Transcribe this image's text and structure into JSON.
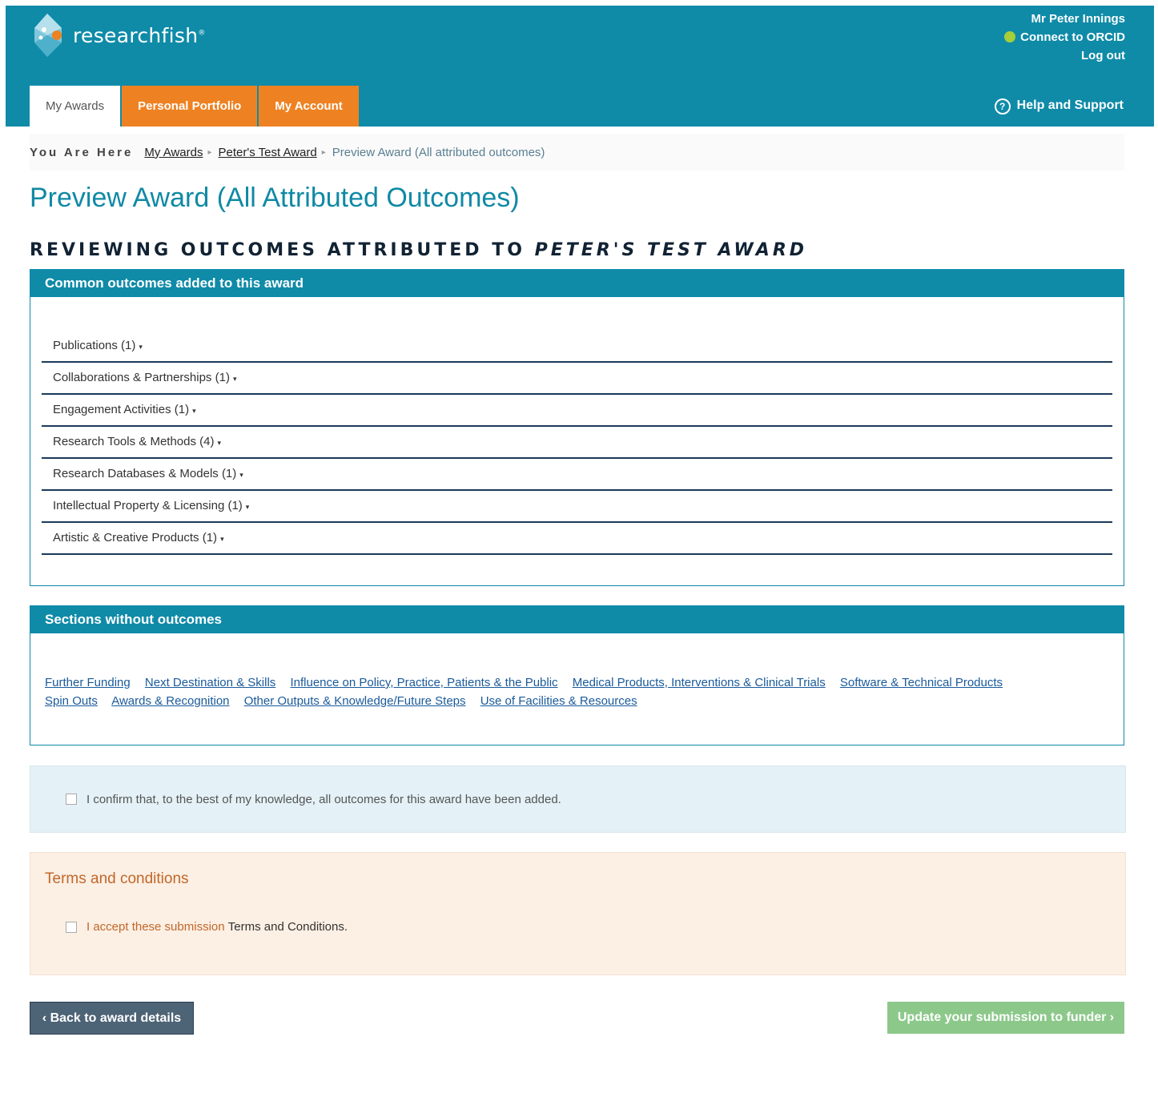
{
  "header": {
    "logo_text": "researchfish",
    "logo_reg": "®",
    "user_name": "Mr Peter Innings",
    "orcid_link": "Connect to ORCID",
    "logout": "Log out",
    "help": "Help and Support",
    "help_icon": "question-circle-icon",
    "tabs": [
      {
        "label": "My Awards",
        "active": true
      },
      {
        "label": "Personal Portfolio",
        "active": false
      },
      {
        "label": "My Account",
        "active": false
      }
    ],
    "colors": {
      "header_bg": "#0f8ba8",
      "tab_orange": "#ee8222"
    }
  },
  "breadcrumb": {
    "prefix": "You Are Here",
    "items": [
      "My Awards",
      "Peter's Test Award"
    ],
    "current": "Preview Award (All attributed outcomes)"
  },
  "page": {
    "title": "Preview Award (All Attributed Outcomes)",
    "subtitle_prefix": "REVIEWING OUTCOMES ATTRIBUTED TO",
    "subtitle_award": "PETER'S TEST AWARD"
  },
  "common_outcomes": {
    "heading": "Common outcomes added to this award",
    "items": [
      "Publications (1)",
      "Collaborations & Partnerships (1)",
      "Engagement Activities (1)",
      "Research Tools & Methods (4)",
      "Research Databases & Models (1)",
      "Intellectual Property & Licensing (1)",
      "Artistic & Creative Products (1)"
    ]
  },
  "sections_without": {
    "heading": "Sections without outcomes",
    "links": [
      "Further Funding",
      "Next Destination & Skills",
      "Influence on Policy, Practice, Patients & the Public",
      "Medical Products, Interventions & Clinical Trials",
      "Software & Technical Products",
      "Spin Outs",
      "Awards & Recognition",
      "Other Outputs & Knowledge/Future Steps",
      "Use of Facilities & Resources"
    ]
  },
  "confirm": {
    "label": "I confirm that, to the best of my knowledge, all outcomes for this award have been added.",
    "checked": false
  },
  "terms": {
    "title": "Terms and conditions",
    "label_part1": "I accept these submission",
    "label_part2": "Terms and Conditions.",
    "checked": false
  },
  "buttons": {
    "back": "Back to award details",
    "update": "Update your submission to funder"
  }
}
